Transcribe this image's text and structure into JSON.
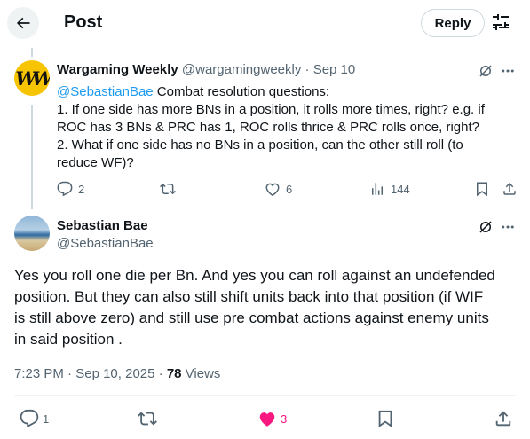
{
  "header": {
    "title": "Post",
    "reply_label": "Reply",
    "back_icon": "arrow-left-icon",
    "tune_icon": "sliders-icon"
  },
  "quoted_post": {
    "avatar_text": "WW",
    "author_name": "Wargaming Weekly",
    "handle": "@wargamingweekly",
    "separator": "·",
    "date": "Sep 10",
    "mention": "@SebastianBae",
    "lines": [
      " Combat resolution questions:",
      "1. If one side has more BNs in a position, it rolls more times, right? e.g. if",
      "ROC has 3 BNs & PRC has 1, ROC rolls thrice & PRC rolls once, right?",
      "2. What if one side has no BNs in a position, can the other still roll (to",
      "reduce WF)?"
    ],
    "stats": {
      "replies": "2",
      "likes": "6",
      "views": "144"
    }
  },
  "main_post": {
    "author_name": "Sebastian Bae",
    "handle": "@SebastianBae",
    "lines": [
      "Yes you roll one die per Bn. And yes you can roll against an undefended",
      "position. But they can also still shift units back into that position (if WIF",
      "is still above zero) and still use pre combat actions against enemy units",
      "in said position ."
    ],
    "time": "7:23 PM",
    "separator": "·",
    "date": "Sep 10, 2025",
    "views_count": "78",
    "views_label": "Views",
    "stats": {
      "replies": "1",
      "likes": "3"
    }
  },
  "colors": {
    "text": "#0f1419",
    "secondary": "#536471",
    "link": "#1d9bf0",
    "like_active": "#f91880",
    "border": "#cfd9de"
  }
}
